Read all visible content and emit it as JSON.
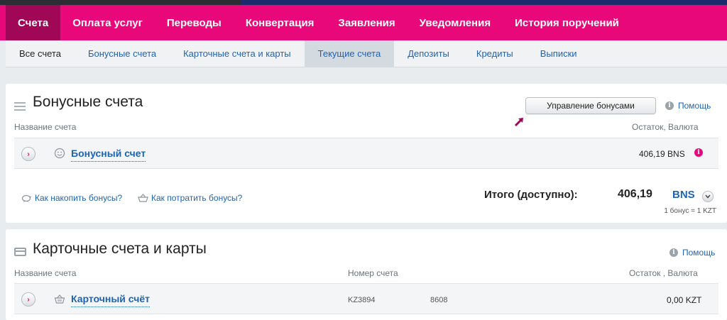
{
  "main_nav": [
    "Счета",
    "Оплата услуг",
    "Переводы",
    "Конвертация",
    "Заявления",
    "Уведомления",
    "История поручений"
  ],
  "sub_nav": [
    "Все счета",
    "Бонусные счета",
    "Карточные счета и карты",
    "Текущие счета",
    "Депозиты",
    "Кредиты",
    "Выписки"
  ],
  "bonus": {
    "title": "Бонусные счета",
    "manage_button": "Управление бонусами",
    "help": "Помощь",
    "col_name": "Название счета",
    "col_balance": "Остаток, Валюта",
    "account_name": "Бонусный счет",
    "account_amount": "406,19 BNS",
    "link_earn": "Как накопить бонусы?",
    "link_spend": "Как потратить бонусы?",
    "total_label": "Итого (доступно):",
    "total_value": "406,19",
    "total_currency": "BNS",
    "rate": "1 бонус = 1 KZT"
  },
  "cards": {
    "title": "Карточные счета и карты",
    "help": "Помощь",
    "col_name": "Название счета",
    "col_number": "Номер счета",
    "col_balance": "Остаток , Валюта",
    "account_name": "Карточный счёт",
    "account_number_prefix": "KZ3894",
    "account_number_suffix": "8608",
    "account_amount": "0,00 KZT"
  },
  "colors": {
    "brand": "#e8087a",
    "brand_dark": "#a00757",
    "link": "#1e64b4"
  },
  "icons": [
    "list-icon",
    "smiley-icon",
    "info-icon",
    "alert-icon",
    "piggy-bank-icon",
    "basket-icon",
    "card-icon",
    "arrow-icon",
    "chevron-right-icon",
    "chevron-down-icon"
  ]
}
